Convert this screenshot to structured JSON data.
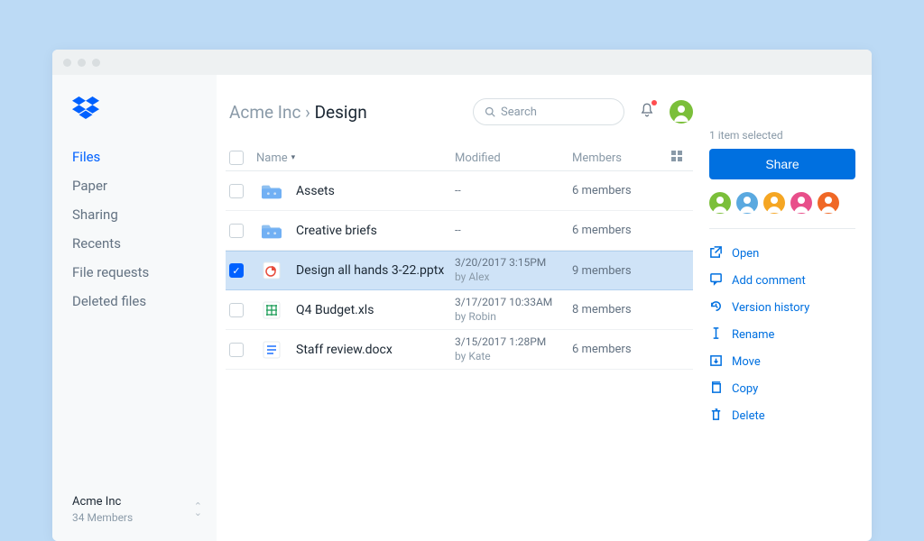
{
  "sidebar": {
    "nav": [
      {
        "label": "Files",
        "active": true
      },
      {
        "label": "Paper"
      },
      {
        "label": "Sharing"
      },
      {
        "label": "Recents"
      },
      {
        "label": "File requests"
      },
      {
        "label": "Deleted files"
      }
    ],
    "org": {
      "name": "Acme Inc",
      "members": "34 Members"
    }
  },
  "breadcrumb": {
    "parent": "Acme Inc",
    "sep": "›",
    "current": "Design"
  },
  "search": {
    "placeholder": "Search"
  },
  "columns": {
    "name": "Name",
    "modified": "Modified",
    "members": "Members"
  },
  "files": [
    {
      "name": "Assets",
      "modified": "--",
      "by": "",
      "members": "6 members",
      "type": "folder"
    },
    {
      "name": "Creative briefs",
      "modified": "--",
      "by": "",
      "members": "6 members",
      "type": "folder"
    },
    {
      "name": "Design all hands 3-22.pptx",
      "modified": "3/20/2017 3:15PM",
      "by": "by Alex",
      "members": "9 members",
      "type": "ppt",
      "selected": true
    },
    {
      "name": "Q4 Budget.xls",
      "modified": "3/17/2017 10:33AM",
      "by": "by Robin",
      "members": "8 members",
      "type": "xls"
    },
    {
      "name": "Staff review.docx",
      "modified": "3/15/2017 1:28PM",
      "by": "by Kate",
      "members": "6 members",
      "type": "doc"
    }
  ],
  "panel": {
    "selected": "1 item selected",
    "share": "Share",
    "member_colors": [
      "#7bbf3a",
      "#5aa9e0",
      "#f5a623",
      "#e84f8a",
      "#f06826"
    ],
    "actions": [
      {
        "icon": "open",
        "label": "Open"
      },
      {
        "icon": "comment",
        "label": "Add comment"
      },
      {
        "icon": "history",
        "label": "Version history"
      },
      {
        "icon": "rename",
        "label": "Rename"
      },
      {
        "icon": "move",
        "label": "Move"
      },
      {
        "icon": "copy",
        "label": "Copy"
      },
      {
        "icon": "delete",
        "label": "Delete"
      }
    ]
  }
}
